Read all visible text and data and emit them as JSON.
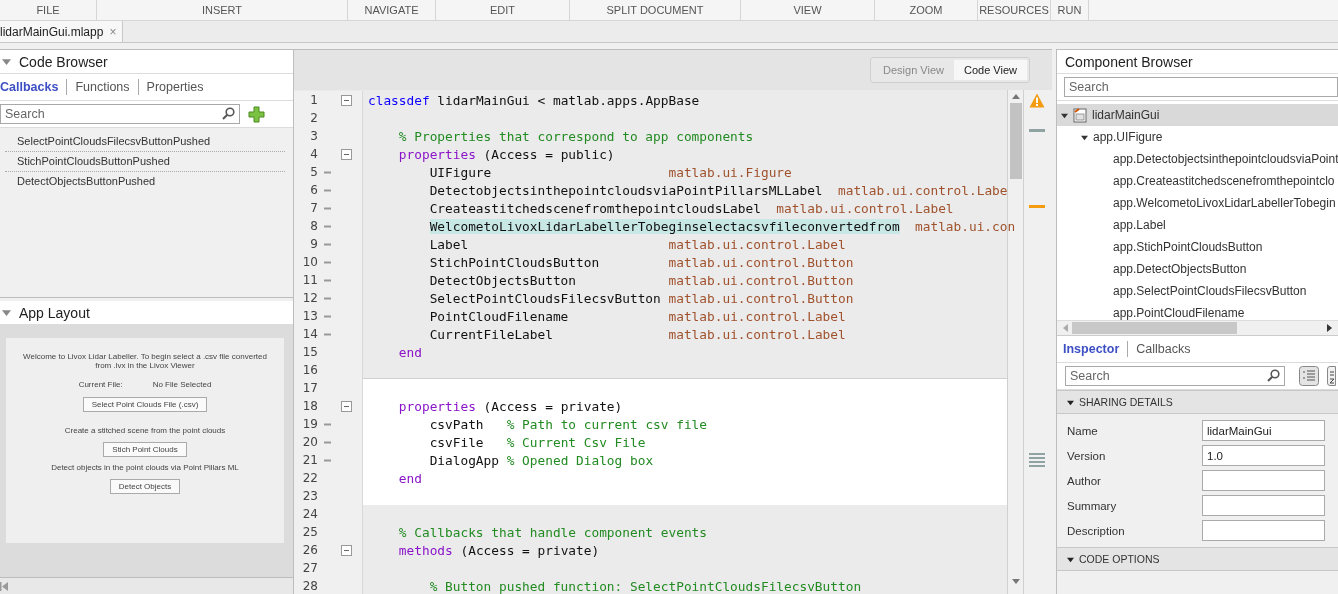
{
  "menu": [
    {
      "label": "FILE"
    },
    {
      "label": "INSERT"
    },
    {
      "label": "NAVIGATE"
    },
    {
      "label": "EDIT"
    },
    {
      "label": "SPLIT DOCUMENT"
    },
    {
      "label": "VIEW"
    },
    {
      "label": "ZOOM"
    },
    {
      "label": "RESOURCES"
    },
    {
      "label": "RUN"
    }
  ],
  "document_tab": {
    "label": "lidarMainGui.mlapp",
    "close": "×"
  },
  "code_browser": {
    "title": "Code Browser",
    "tabs": [
      {
        "label": "Callbacks",
        "selected": true
      },
      {
        "label": "Functions",
        "selected": false
      },
      {
        "label": "Properties",
        "selected": false
      }
    ],
    "search": {
      "placeholder": "Search"
    },
    "items": [
      "SelectPointCloudsFilecsvButtonPushed",
      "StichPointCloudsButtonPushed",
      "DetectObjectsButtonPushed"
    ]
  },
  "app_layout": {
    "title": "App Layout",
    "preview": {
      "welcome": "Welcome to Livox Lidar Labeller. To begin select a .csv file converted from .lvx in the Livox Viewer",
      "current_file_label": "Current File:",
      "current_file_value": "No File Selected",
      "select_button": "Select Point Clouds File (.csv)",
      "stitch_text": "Create a stitched scene from the point clouds",
      "stitch_button": "Stich Point Clouds",
      "detect_text": "Detect objects in the point clouds via Point Pillars ML",
      "detect_button": "Detect Objects"
    }
  },
  "editor": {
    "views": [
      {
        "label": "Design View",
        "selected": false
      },
      {
        "label": "Code View",
        "selected": true
      }
    ],
    "sections": [
      {
        "current": false,
        "lines": [
          {
            "number": "1",
            "kind": "fold",
            "tokens": [
              {
                "text": "classdef",
                "kind": "keyword"
              },
              {
                "text": " lidarMainGui < matlab.apps.AppBase",
                "kind": "plain"
              }
            ]
          },
          {
            "number": "2",
            "kind": "blank"
          },
          {
            "number": "3",
            "kind": "blank",
            "tokens": [
              {
                "text": "    % Properties that correspond to app components",
                "kind": "comment"
              }
            ]
          },
          {
            "number": "4",
            "kind": "fold",
            "tokens": [
              {
                "text": "    properties",
                "kind": "block"
              },
              {
                "text": " (Access = public)",
                "kind": "plain"
              }
            ]
          },
          {
            "number": "5",
            "kind": "statement",
            "tokens": [
              {
                "text": "        UIFigure",
                "kind": "plain"
              },
              {
                "text": "                       matlab.ui.Figure",
                "kind": "type"
              }
            ]
          },
          {
            "number": "6",
            "kind": "statement",
            "tokens": [
              {
                "text": "        DetectobjectsinthepointcloudsviaPointPillarsMLLabel",
                "kind": "plain"
              },
              {
                "text": "  matlab.ui.control.Labe",
                "kind": "type"
              }
            ]
          },
          {
            "number": "7",
            "kind": "statement",
            "tokens": [
              {
                "text": "        CreateastitchedscenefromthepointcloudsLabel",
                "kind": "plain"
              },
              {
                "text": "  matlab.ui.control.Label",
                "kind": "type"
              }
            ]
          },
          {
            "number": "8",
            "kind": "statement",
            "tokens": [
              {
                "text": "        WelcometoLivoxLidarLabellerTobeginselectacsvfileconvertedfrom",
                "kind": "match"
              },
              {
                "text": "  matlab.ui.con",
                "kind": "type"
              }
            ]
          },
          {
            "number": "9",
            "kind": "statement",
            "tokens": [
              {
                "text": "        Label",
                "kind": "plain"
              },
              {
                "text": "                          matlab.ui.control.Label",
                "kind": "type"
              }
            ]
          },
          {
            "number": "10",
            "kind": "statement",
            "tokens": [
              {
                "text": "        StichPointCloudsButton",
                "kind": "plain"
              },
              {
                "text": "         matlab.ui.control.Button",
                "kind": "type"
              }
            ]
          },
          {
            "number": "11",
            "kind": "statement",
            "tokens": [
              {
                "text": "        DetectObjectsButton",
                "kind": "plain"
              },
              {
                "text": "            matlab.ui.control.Button",
                "kind": "type"
              }
            ]
          },
          {
            "number": "12",
            "kind": "statement",
            "tokens": [
              {
                "text": "        SelectPointCloudsFilecsvButton",
                "kind": "plain"
              },
              {
                "text": " matlab.ui.control.Button",
                "kind": "type"
              }
            ]
          },
          {
            "number": "13",
            "kind": "statement",
            "tokens": [
              {
                "text": "        PointCloudFilename",
                "kind": "plain"
              },
              {
                "text": "             matlab.ui.control.Label",
                "kind": "type"
              }
            ]
          },
          {
            "number": "14",
            "kind": "statement",
            "tokens": [
              {
                "text": "        CurrentFileLabel",
                "kind": "plain"
              },
              {
                "text": "               matlab.ui.control.Label",
                "kind": "type"
              }
            ]
          },
          {
            "number": "15",
            "kind": "blank",
            "tokens": [
              {
                "text": "    end",
                "kind": "block"
              }
            ]
          },
          {
            "number": "16",
            "kind": "blank"
          }
        ]
      },
      {
        "current": true,
        "lines": [
          {
            "number": "17",
            "kind": "blank"
          },
          {
            "number": "18",
            "kind": "fold",
            "tokens": [
              {
                "text": "    properties",
                "kind": "block"
              },
              {
                "text": " (Access = private)",
                "kind": "plain"
              }
            ]
          },
          {
            "number": "19",
            "kind": "statement",
            "tokens": [
              {
                "text": "        csvPath   ",
                "kind": "plain"
              },
              {
                "text": "% Path to current csv file",
                "kind": "comment"
              }
            ]
          },
          {
            "number": "20",
            "kind": "statement",
            "tokens": [
              {
                "text": "        csvFile   ",
                "kind": "plain"
              },
              {
                "text": "% Current Csv File",
                "kind": "comment"
              }
            ]
          },
          {
            "number": "21",
            "kind": "statement",
            "tokens": [
              {
                "text": "        DialogApp ",
                "kind": "plain"
              },
              {
                "text": "% Opened Dialog box",
                "kind": "comment"
              }
            ]
          },
          {
            "number": "22",
            "kind": "blank",
            "tokens": [
              {
                "text": "    end",
                "kind": "block"
              }
            ]
          },
          {
            "number": "23",
            "kind": "blank"
          }
        ]
      },
      {
        "current": false,
        "lines": [
          {
            "number": "24",
            "kind": "blank"
          },
          {
            "number": "25",
            "kind": "blank",
            "tokens": [
              {
                "text": "    % Callbacks that handle component events",
                "kind": "comment"
              }
            ]
          },
          {
            "number": "26",
            "kind": "fold",
            "tokens": [
              {
                "text": "    methods",
                "kind": "block"
              },
              {
                "text": " (Access = private)",
                "kind": "plain"
              }
            ]
          },
          {
            "number": "27",
            "kind": "blank"
          },
          {
            "number": "28",
            "kind": "blank",
            "tokens": [
              {
                "text": "        % Button pushed function: SelectPointCloudsFilecsvButton",
                "kind": "comment"
              }
            ]
          }
        ]
      }
    ]
  },
  "component_browser": {
    "title": "Component Browser",
    "search": {
      "placeholder": "Search"
    },
    "tree": [
      {
        "label": "lidarMainGui",
        "expanded": true,
        "selected": true,
        "children": [
          {
            "label": "app.UIFigure",
            "expanded": true,
            "selected": false,
            "children": [
              {
                "label": "app.DetectobjectsinthepointcloudsviaPoint",
                "selected": false
              },
              {
                "label": "app.Createastitchedscenefromthepointclo",
                "selected": false
              },
              {
                "label": "app.WelcometoLivoxLidarLabellerTobegin",
                "selected": false
              },
              {
                "label": "app.Label",
                "selected": false
              },
              {
                "label": "app.StichPointCloudsButton",
                "selected": false
              },
              {
                "label": "app.DetectObjectsButton",
                "selected": false
              },
              {
                "label": "app.SelectPointCloudsFilecsvButton",
                "selected": false
              },
              {
                "label": "app.PointCloudFilename",
                "selected": false
              }
            ]
          }
        ]
      }
    ]
  },
  "inspector": {
    "tabs": [
      {
        "label": "Inspector",
        "selected": true
      },
      {
        "label": "Callbacks",
        "selected": false
      }
    ],
    "search": {
      "placeholder": "Search"
    },
    "sections": [
      {
        "title": "SHARING DETAILS",
        "expanded": true,
        "fields": [
          {
            "label": "Name",
            "value": "lidarMainGui"
          },
          {
            "label": "Version",
            "value": "1.0"
          },
          {
            "label": "Author"
          },
          {
            "label": "Summary"
          },
          {
            "label": "Description"
          }
        ]
      },
      {
        "title": "CODE OPTIONS",
        "expanded": true
      }
    ]
  }
}
